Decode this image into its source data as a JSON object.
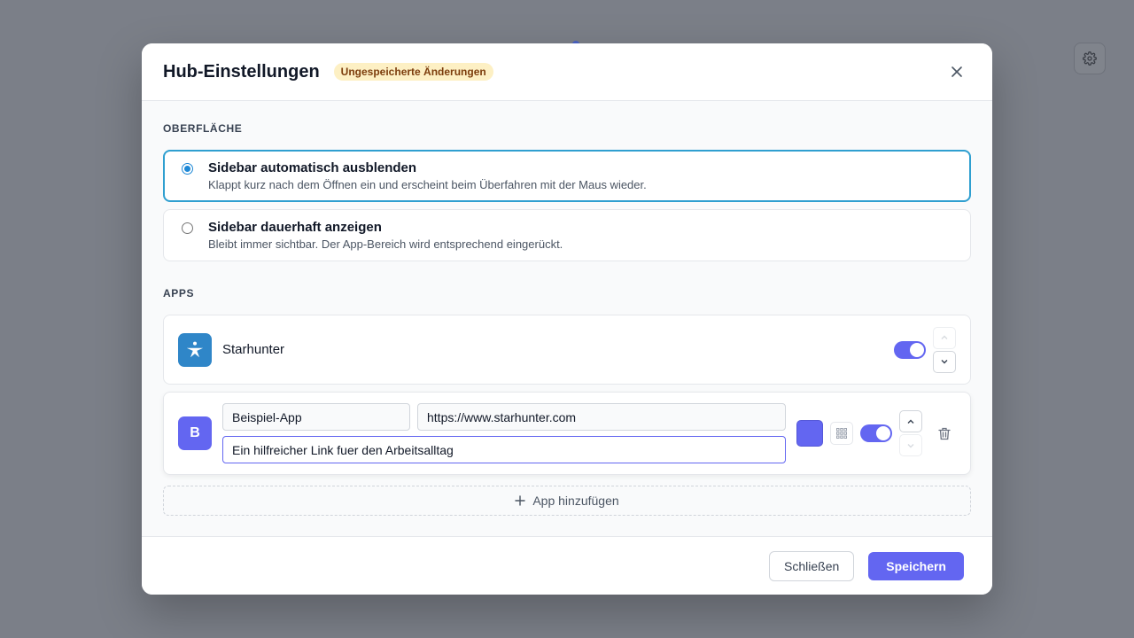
{
  "modal": {
    "title": "Hub-Einstellungen",
    "unsaved_badge": "Ungespeicherte Änderungen",
    "close_icon": "close-icon"
  },
  "interface": {
    "section_title": "OBERFLÄCHE",
    "options": [
      {
        "label": "Sidebar automatisch ausblenden",
        "description": "Klappt kurz nach dem Öffnen ein und erscheint beim Überfahren mit der Maus wieder.",
        "selected": true
      },
      {
        "label": "Sidebar dauerhaft anzeigen",
        "description": "Bleibt immer sichtbar. Der App-Bereich wird entsprechend eingerückt.",
        "selected": false
      }
    ]
  },
  "apps": {
    "section_title": "APPS",
    "items": [
      {
        "name": "Starhunter",
        "icon": "starhunter-logo-icon",
        "enabled": true,
        "move_up_enabled": false,
        "move_down_enabled": true
      },
      {
        "icon_letter": "B",
        "name_value": "Beispiel-App",
        "url_value": "https://www.starhunter.com",
        "description_value": "Ein hilfreicher Link fuer den Arbeitsalltag",
        "color": "#6366f1",
        "enabled": true,
        "move_up_enabled": true,
        "move_down_enabled": false
      }
    ],
    "add_label": "App hinzufügen"
  },
  "footer": {
    "close_label": "Schließen",
    "save_label": "Speichern"
  },
  "colors": {
    "accent": "#6366f1",
    "selected_border": "#2f9fd0",
    "badge_bg": "#fdf0c4",
    "badge_text": "#7c3d0c",
    "overlay": "#7b7f88"
  }
}
